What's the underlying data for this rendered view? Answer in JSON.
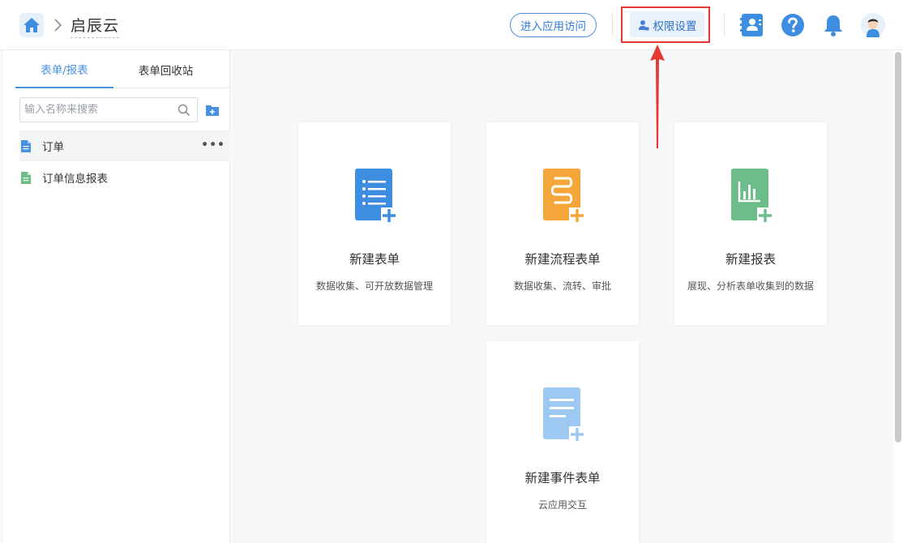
{
  "header": {
    "app_name": "启辰云",
    "enter_app_label": "进入应用访问",
    "permission_label": "权限设置"
  },
  "sidebar": {
    "tabs": [
      {
        "label": "表单/报表",
        "active": true
      },
      {
        "label": "表单回收站",
        "active": false
      }
    ],
    "search": {
      "placeholder": "输入名称来搜索",
      "value": ""
    },
    "items": [
      {
        "label": "订单",
        "icon": "form-file-icon",
        "more": "•••"
      },
      {
        "label": "订单信息报表",
        "icon": "report-file-icon"
      }
    ]
  },
  "cards": [
    {
      "title": "新建表单",
      "desc": "数据收集、可开放数据管理",
      "icon": "new-form-icon",
      "color": "#3d8de0"
    },
    {
      "title": "新建流程表单",
      "desc": "数据收集、流转、审批",
      "icon": "new-flow-form-icon",
      "color": "#f5a63b"
    },
    {
      "title": "新建报表",
      "desc": "展现、分析表单收集到的数据",
      "icon": "new-report-icon",
      "color": "#6cbd8a"
    },
    {
      "title": "新建事件表单",
      "desc": "云应用交互",
      "icon": "new-event-form-icon",
      "color": "#9cc8f2"
    }
  ],
  "colors": {
    "accent": "#4a8fe0",
    "highlight": "#e53935"
  }
}
